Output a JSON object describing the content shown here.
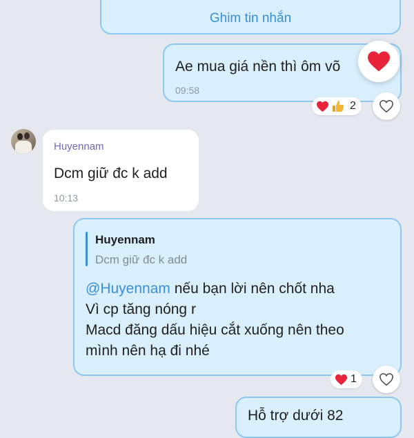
{
  "pinned": {
    "label": "Ghim tin nhắn"
  },
  "messages": [
    {
      "id": "m1",
      "text": "Ae mua giá nền thì ôm võ",
      "time": "09:58",
      "reactions": {
        "count": "2",
        "icons": [
          "heart-icon",
          "thumbs-up-icon"
        ]
      }
    },
    {
      "id": "m2",
      "sender": "Huyennam",
      "text": "Dcm giữ đc k add",
      "time": "10:13"
    },
    {
      "id": "m3",
      "quote": {
        "sender": "Huyennam",
        "text": "Dcm giữ đc k add"
      },
      "mention": "@Huyennam",
      "line1_rest": " nếu bạn lời nên chốt nha",
      "line2": "Vì cp tăng nóng r",
      "line3": "Macd đăng dấu hiệu cắt xuống nên theo",
      "line4": "mình nên hạ đi nhé",
      "reactions": {
        "count": "1",
        "icons": [
          "heart-icon"
        ]
      }
    },
    {
      "id": "m4",
      "text": "Hỗ trợ dưới 82"
    }
  ],
  "colors": {
    "accent": "#3a8fd6",
    "bubble_mine": "#d9effc",
    "heart": "#e8233a"
  }
}
